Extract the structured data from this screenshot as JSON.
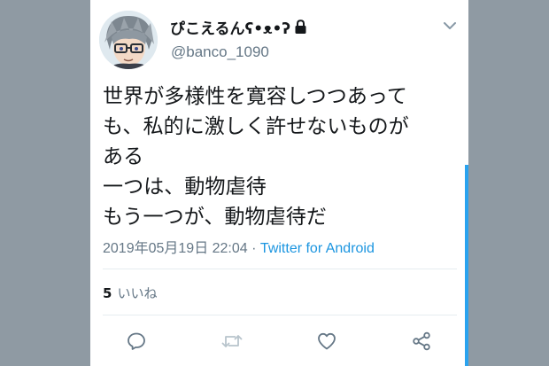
{
  "user": {
    "display_name": "ぴこえるんʕ•ᴥ•ʔ",
    "handle": "@banco_1090",
    "protected_icon": "lock-icon",
    "avatar_icon": "anime-avatar-glasses"
  },
  "tweet": {
    "lines": [
      "世界が多様性を寛容しつつあって",
      "も、私的に激しく許せないものが",
      "ある",
      "一つは、動物虐待",
      "もう一つが、動物虐待だ"
    ],
    "timestamp": "2019年05月19日 22:04",
    "separator": "·",
    "source": "Twitter for Android"
  },
  "stats": {
    "likes_count": "5",
    "likes_label": "いいね"
  },
  "actions": {
    "reply_icon": "reply-icon",
    "retweet_icon": "retweet-icon",
    "like_icon": "heart-icon",
    "share_icon": "share-icon",
    "menu_icon": "chevron-down-icon"
  },
  "colors": {
    "background": "#8f9aa3",
    "card": "#ffffff",
    "text": "#14171a",
    "secondary": "#657786",
    "link": "#1b95e0",
    "scrollbar": "#2aa3ef"
  }
}
